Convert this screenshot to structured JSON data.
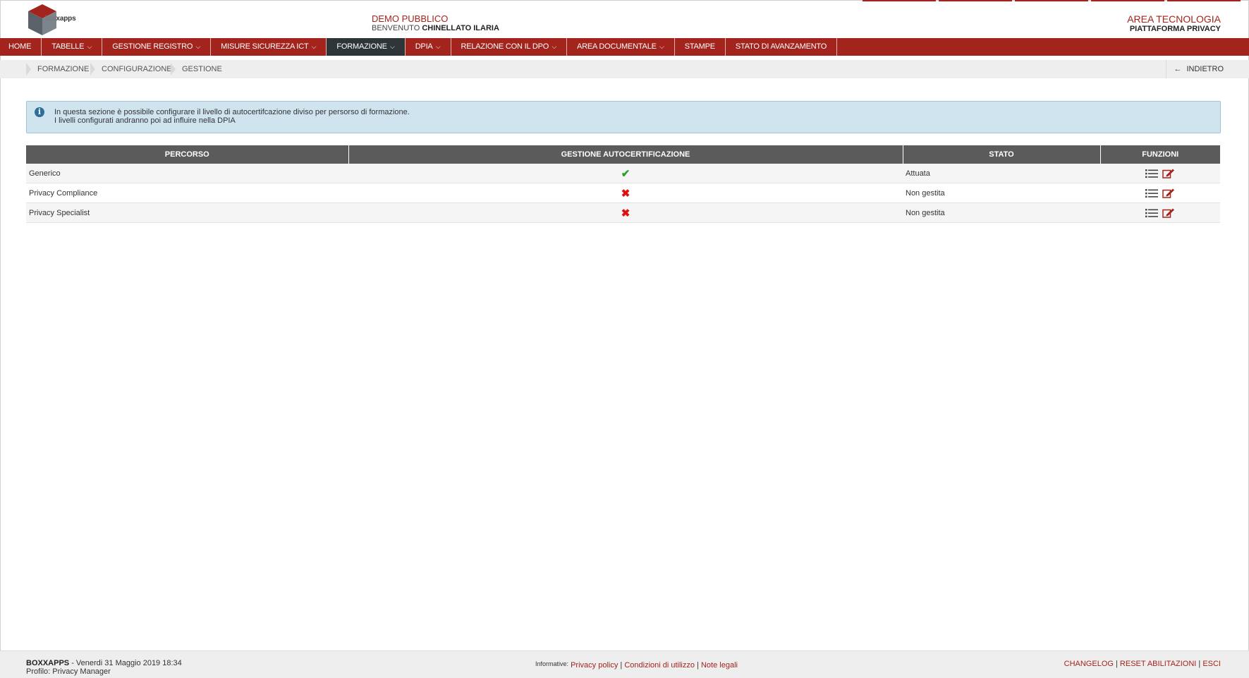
{
  "header": {
    "logo_prefix": "box",
    "logo_suffix": "xapps",
    "company": "DEMO PUBBLICO",
    "welcome_label": "BENVENUTO",
    "user_name": "CHINELLATO ILARIA",
    "area": "AREA TECNOLOGIA",
    "platform": "PIATTAFORMA PRIVACY"
  },
  "nav": {
    "items": [
      {
        "label": "HOME"
      },
      {
        "label": "TABELLE"
      },
      {
        "label": "GESTIONE REGISTRO"
      },
      {
        "label": "MISURE SICUREZZA ICT"
      },
      {
        "label": "FORMAZIONE"
      },
      {
        "label": "DPIA"
      },
      {
        "label": "RELAZIONE CON IL DPO"
      },
      {
        "label": "AREA DOCUMENTALE"
      },
      {
        "label": "STAMPE"
      },
      {
        "label": "STATO DI AVANZAMENTO"
      }
    ]
  },
  "breadcrumb": {
    "items": [
      {
        "label": "FORMAZIONE"
      },
      {
        "label": "CONFIGURAZIONE"
      },
      {
        "label": "GESTIONE"
      }
    ],
    "back_label": "INDIETRO"
  },
  "info": {
    "line1": "In questa sezione è possibile configurare il livello di autocertifcazione diviso per persorso di formazione.",
    "line2": "I livelli configurati andranno poi ad influire nella DPIA"
  },
  "table": {
    "headers": [
      "PERCORSO",
      "GESTIONE AUTOCERTIFICAZIONE",
      "STATO",
      "FUNZIONI"
    ],
    "rows": [
      {
        "percorso": "Generico",
        "autocert": "check",
        "stato": "Attuata"
      },
      {
        "percorso": "Privacy Compliance",
        "autocert": "cross",
        "stato": "Non gestita"
      },
      {
        "percorso": "Privacy Specialist",
        "autocert": "cross",
        "stato": "Non gestita"
      }
    ]
  },
  "footer": {
    "app": "BOXXAPPS",
    "datetime": " - Venerdi 31 Maggio 2019 18:34",
    "profile": "Profilo: Privacy Manager",
    "informative_label": "Informative:",
    "privacy_policy": "Privacy policy",
    "conditions": "Condizioni di utilizzo",
    "legal_notes": "Note legali",
    "changelog": "CHANGELOG",
    "reset": "RESET ABILITAZIONI",
    "exit": "ESCI"
  },
  "colors": {
    "brand": "#a3241c",
    "nav_active": "#2e3539",
    "table_header": "#5b5b5b",
    "info_bg": "#cfe4ef",
    "ok": "#2aa12a",
    "no": "#e01010"
  },
  "icons": [
    "cube-logo-icon",
    "chevron-down-icon",
    "arrow-left-icon",
    "info-icon",
    "check-icon",
    "cross-icon",
    "list-icon",
    "edit-icon"
  ]
}
